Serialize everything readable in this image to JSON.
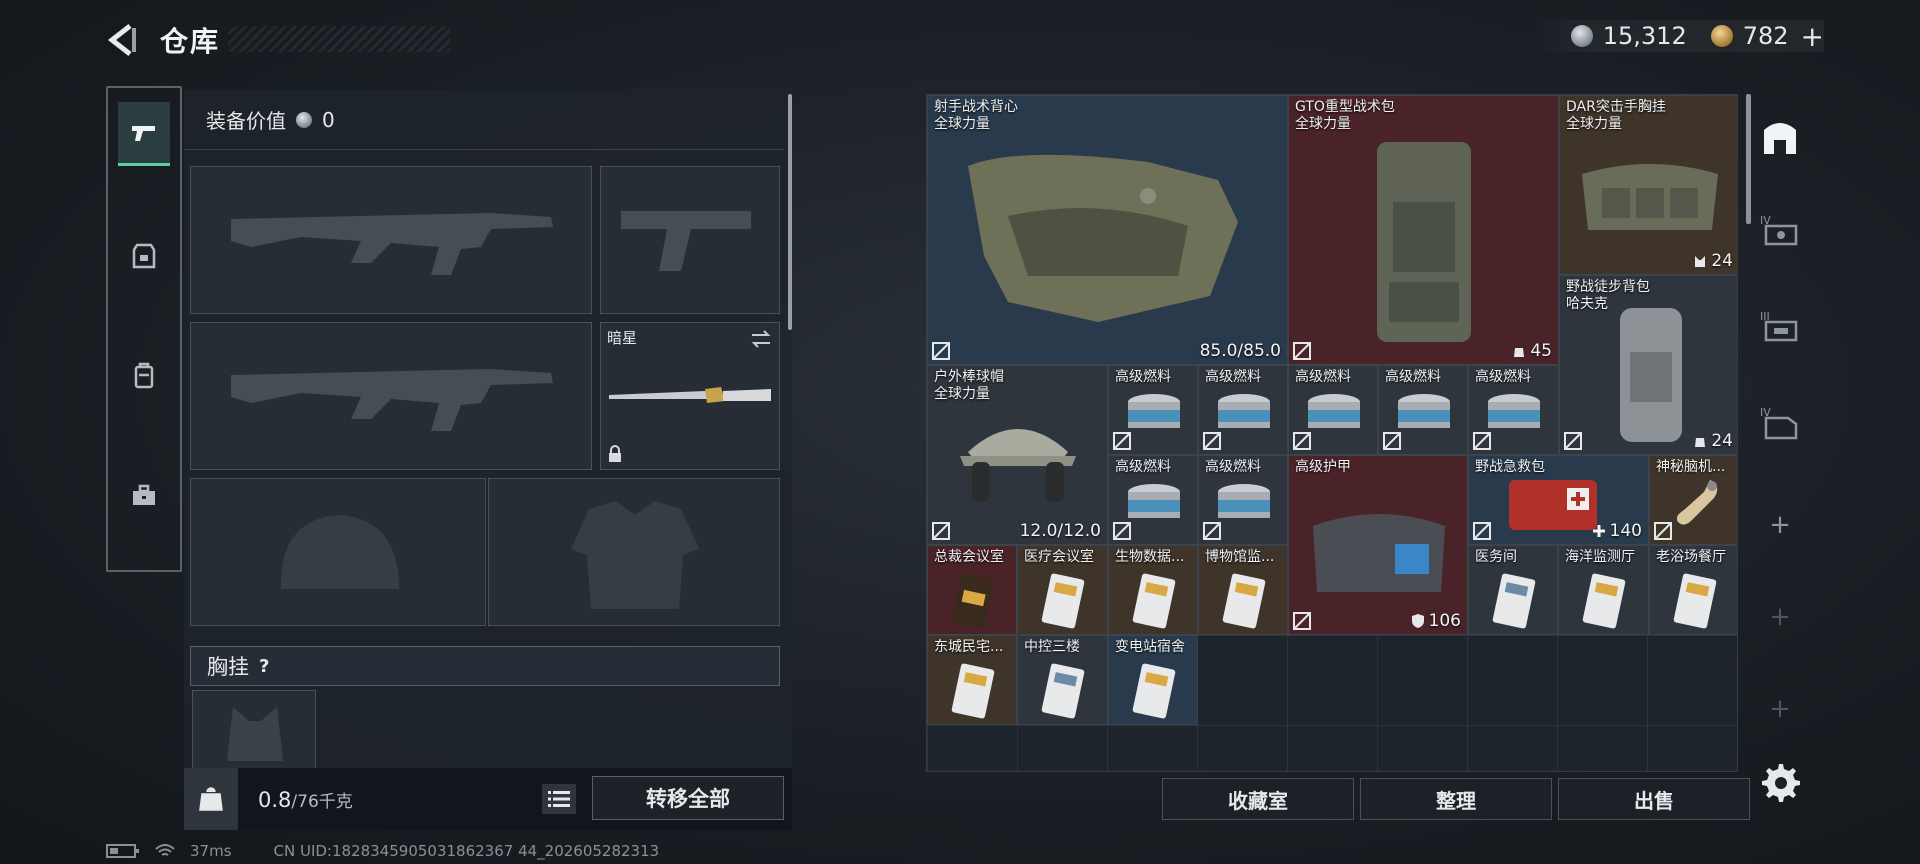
{
  "header": {
    "title": "仓库"
  },
  "currency": {
    "silver": "15,312",
    "gold": "782",
    "add": "+"
  },
  "equipment": {
    "value_label": "装备价值",
    "value": "0",
    "melee_name": "暗星",
    "chest_label": "胸挂",
    "chest_help": "?"
  },
  "weight": {
    "current": "0.8",
    "capacity": "/76千克",
    "transfer_all": "转移全部"
  },
  "status": {
    "ping": "37ms",
    "uid": "CN UID:1828345905031862367 44_202605282313"
  },
  "items": [
    {
      "name": "射手战术背心",
      "sub": "全球力量",
      "stat": "85.0/85.0",
      "color": "blue"
    },
    {
      "name": "GTO重型战术包",
      "sub": "全球力量",
      "stat": "45",
      "color": "red"
    },
    {
      "name": "DAR突击手胸挂",
      "sub": "全球力量",
      "stat": "24",
      "color": "brown"
    },
    {
      "name": "野战徒步背包",
      "sub": "哈夫克",
      "stat": "24",
      "color": "gray"
    },
    {
      "name": "户外棒球帽",
      "sub": "全球力量",
      "stat": "12.0/12.0",
      "color": "gray"
    },
    {
      "name": "高级燃料",
      "color": "gray"
    },
    {
      "name": "高级燃料",
      "color": "gray"
    },
    {
      "name": "高级燃料",
      "color": "gray"
    },
    {
      "name": "高级燃料",
      "color": "gray"
    },
    {
      "name": "高级燃料",
      "color": "gray"
    },
    {
      "name": "高级燃料",
      "color": "gray"
    },
    {
      "name": "高级燃料",
      "color": "gray"
    },
    {
      "name": "高级护甲",
      "stat": "106",
      "color": "red"
    },
    {
      "name": "野战急救包",
      "stat": "140",
      "color": "blue"
    },
    {
      "name": "神秘脑机...",
      "color": "brown"
    },
    {
      "name": "总裁会议室",
      "color": "red"
    },
    {
      "name": "医疗会议室",
      "color": "brown"
    },
    {
      "name": "生物数据...",
      "color": "brown"
    },
    {
      "name": "博物馆监...",
      "color": "brown"
    },
    {
      "name": "医务间",
      "color": "gray"
    },
    {
      "name": "海洋监测厅",
      "color": "gray"
    },
    {
      "name": "老浴场餐厅",
      "color": "gray"
    },
    {
      "name": "东城民宅...",
      "color": "brown"
    },
    {
      "name": "中控三楼",
      "color": "gray"
    },
    {
      "name": "变电站宿舍",
      "color": "blue"
    }
  ],
  "buttons": {
    "collection": "收藏室",
    "organize": "整理",
    "sell": "出售"
  },
  "colors": {
    "accent": "#58d0a2",
    "red_tier": "#4a2328",
    "blue_tier": "#283a4c",
    "gold_tier": "#3e342a"
  }
}
